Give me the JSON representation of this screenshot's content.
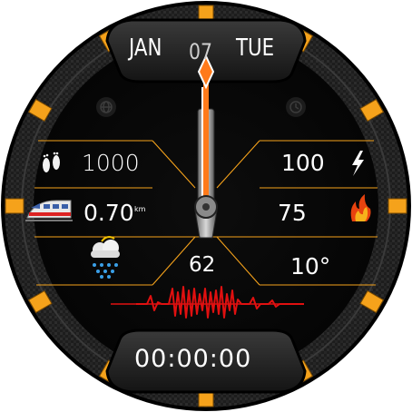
{
  "date": {
    "month": "JAN",
    "day_of_month": "07",
    "weekday": "TUE"
  },
  "stats": {
    "steps": "1000",
    "battery": "100",
    "distance": "0.70",
    "distance_unit": "km",
    "calories": "75",
    "heart_rate": "62",
    "temperature": "10°"
  },
  "stopwatch": "00:00:00",
  "icons": {
    "steps": "footprints-icon",
    "battery": "lightning-bolt-icon",
    "distance": "train-icon",
    "calories": "fire-icon",
    "weather": "rain-cloud-icon",
    "left_button": "globe-icon",
    "right_button": "clock-icon"
  },
  "colors": {
    "accent": "#f5a21b",
    "hand": "#ff7a1a",
    "pulse": "#e01010",
    "background": "#0a0a0a"
  }
}
